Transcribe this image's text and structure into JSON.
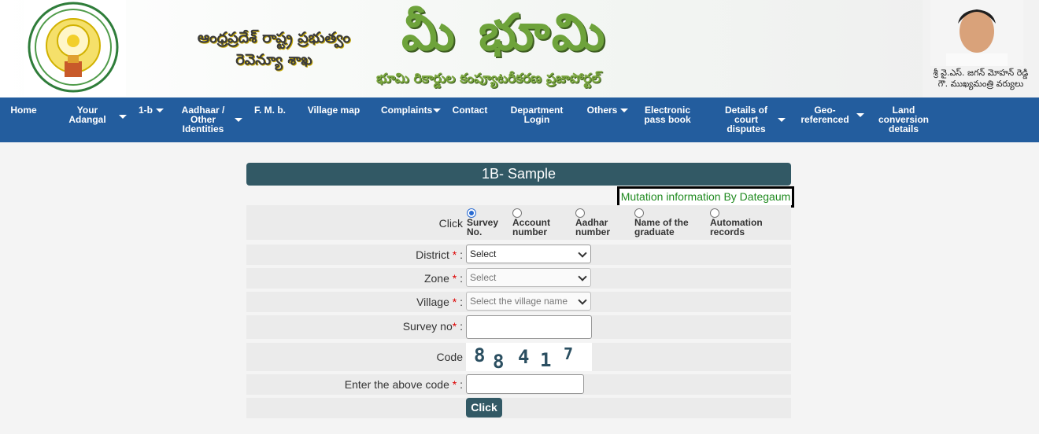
{
  "header": {
    "gov_name_line1": "ఆంధ్రప్రదేశ్ రాష్ట్ర ప్రభుత్వం",
    "gov_name_line2": "రెవెన్యూ శాఖ",
    "brand": "మీ భూమి",
    "tagline": "భూమి రికార్డుల కంప్యూటరీకరణ ప్రజాపోర్టల్",
    "cm_name": "శ్రీ వై.ఎస్. జగన్ మోహన్ రెడ్డి",
    "cm_title": "గౌ. ముఖ్యమంత్రి వర్యులు"
  },
  "nav": {
    "home": "Home",
    "your_adangal": [
      "Your",
      "Adangal"
    ],
    "one_b": "1-b",
    "aadhaar": [
      "Aadhaar /",
      "Other",
      "Identities"
    ],
    "fmb": "F. M. b.",
    "village_map": "Village map",
    "complaints": "Complaints",
    "contact": "Contact",
    "dept_login": [
      "Department",
      "Login"
    ],
    "others": "Others",
    "epass": [
      "Electronic",
      "pass book"
    ],
    "court": [
      "Details of",
      "court",
      "disputes"
    ],
    "geo": [
      "Geo-",
      "referenced"
    ],
    "land_conv": [
      "Land",
      "conversion",
      "details"
    ]
  },
  "form": {
    "title": "1B- Sample",
    "mutation_link": "Mutation information By Dategaum",
    "click_label": "Click",
    "search_options": [
      {
        "line1": "Survey",
        "line2": "No.",
        "checked": true
      },
      {
        "line1": "Account",
        "line2": "number",
        "checked": false
      },
      {
        "line1": "Aadhar",
        "line2": "number",
        "checked": false
      },
      {
        "line1": "Name of the",
        "line2": "graduate",
        "checked": false
      },
      {
        "line1": "Automation",
        "line2": "records",
        "checked": false
      }
    ],
    "district_label": "District",
    "district_value": "Select",
    "zone_label": "Zone",
    "zone_value": "Select",
    "village_label": "Village",
    "village_placeholder": "Select the village name",
    "survey_label": "Survey no",
    "code_label": "Code",
    "captcha_digits": [
      "8",
      "8",
      "4",
      "1",
      "7"
    ],
    "enter_code_label": "Enter the above code",
    "required_mark": "*",
    "colon": ":",
    "submit_label": "Click"
  }
}
